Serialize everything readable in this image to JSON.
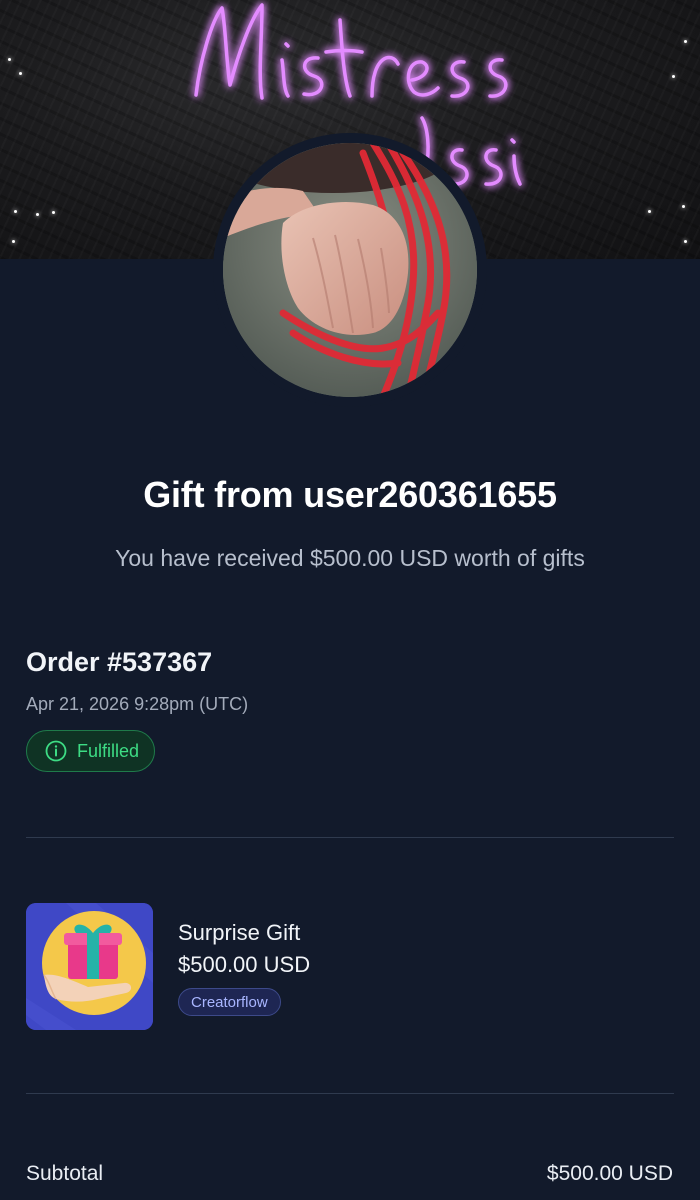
{
  "banner": {
    "neon_text_line1": "Mistress",
    "neon_text_line2": "...ssi"
  },
  "header": {
    "title": "Gift from user260361655",
    "subtitle": "You have received $500.00 USD worth of gifts"
  },
  "order": {
    "number": "Order #537367",
    "date": "Apr 21, 2026 9:28pm (UTC)",
    "status": "Fulfilled",
    "status_icon": "info-icon"
  },
  "item": {
    "name": "Surprise Gift",
    "price": "$500.00 USD",
    "tag": "Creatorflow",
    "thumbnail_icon": "gift-in-hand-icon"
  },
  "totals": {
    "subtotal_label": "Subtotal",
    "subtotal_value": "$500.00 USD"
  },
  "colors": {
    "background": "#121a2b",
    "status_green": "#3ddc84",
    "tag_text": "#a9b6ff",
    "neon_purple": "#d56bff"
  }
}
